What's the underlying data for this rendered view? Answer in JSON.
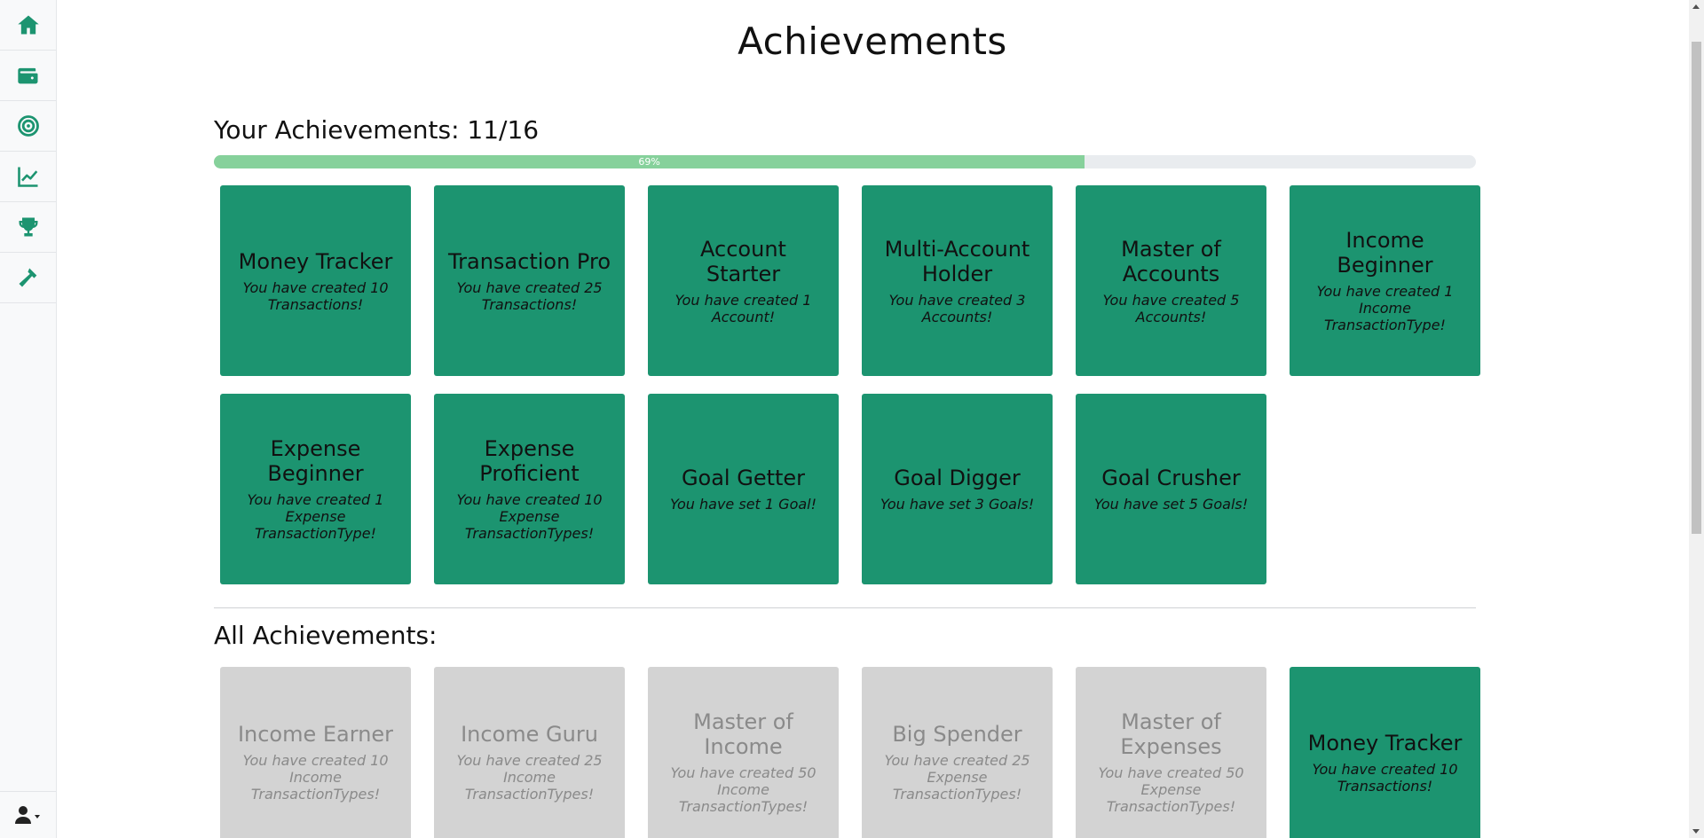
{
  "sidebar": {
    "items": [
      {
        "icon": "home-icon"
      },
      {
        "icon": "wallet-icon"
      },
      {
        "icon": "target-icon"
      },
      {
        "icon": "chart-line-icon"
      },
      {
        "icon": "trophy-icon"
      },
      {
        "icon": "hammer-icon"
      }
    ],
    "user_icon": "user-icon",
    "accent": "#1c9470"
  },
  "page": {
    "title": "Achievements",
    "your_title": "Your Achievements: 11/16",
    "progress_label": "69%",
    "progress_value": 0.69,
    "all_title": "All Achievements:"
  },
  "colors": {
    "earned": "#1c9470",
    "locked": "#d3d3d3",
    "progress": "#86d19b"
  },
  "your_achievements": [
    {
      "title": "Money Tracker",
      "desc": "You have created 10 Transactions!"
    },
    {
      "title": "Transaction Pro",
      "desc": "You have created 25 Transactions!"
    },
    {
      "title": "Account Starter",
      "desc": "You have created 1 Account!"
    },
    {
      "title": "Multi-Account Holder",
      "desc": "You have created 3 Accounts!"
    },
    {
      "title": "Master of Accounts",
      "desc": "You have created 5 Accounts!"
    },
    {
      "title": "Income Beginner",
      "desc": "You have created 1 Income TransactionType!"
    },
    {
      "title": "Expense Beginner",
      "desc": "You have created 1 Expense TransactionType!"
    },
    {
      "title": "Expense Proficient",
      "desc": "You have created 10 Expense TransactionTypes!"
    },
    {
      "title": "Goal Getter",
      "desc": "You have set 1 Goal!"
    },
    {
      "title": "Goal Digger",
      "desc": "You have set 3 Goals!"
    },
    {
      "title": "Goal Crusher",
      "desc": "You have set 5 Goals!"
    }
  ],
  "all_achievements": [
    {
      "title": "Income Earner",
      "desc": "You have created 10 Income TransactionTypes!",
      "earned": false
    },
    {
      "title": "Income Guru",
      "desc": "You have created 25 Income TransactionTypes!",
      "earned": false
    },
    {
      "title": "Master of Income",
      "desc": "You have created 50 Income TransactionTypes!",
      "earned": false
    },
    {
      "title": "Big Spender",
      "desc": "You have created 25 Expense TransactionTypes!",
      "earned": false
    },
    {
      "title": "Master of Expenses",
      "desc": "You have created 50 Expense TransactionTypes!",
      "earned": false
    },
    {
      "title": "Money Tracker",
      "desc": "You have created 10 Transactions!",
      "earned": true
    }
  ]
}
